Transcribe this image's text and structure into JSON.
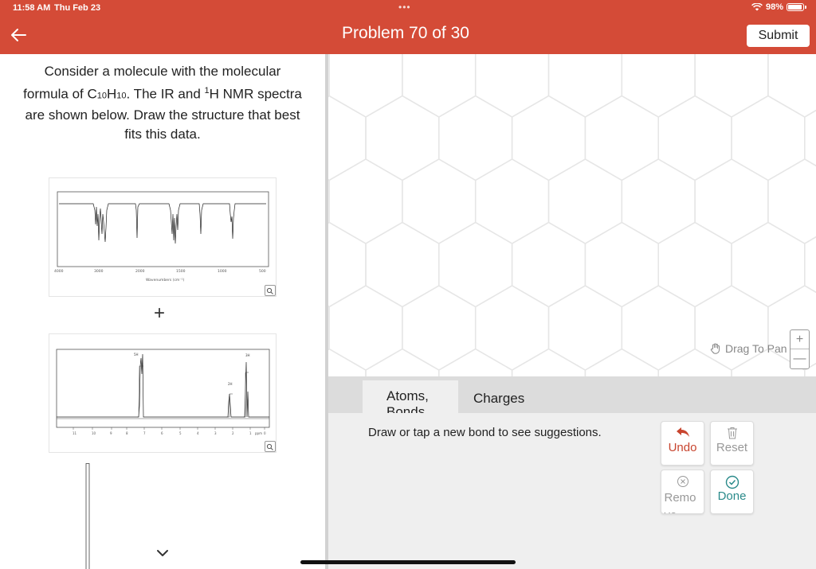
{
  "status_bar": {
    "time": "11:58 AM",
    "date": "Thu Feb 23",
    "battery": "98%"
  },
  "header": {
    "title": "Problem 70 of 30",
    "submit_label": "Submit",
    "color": "#d44b37"
  },
  "question": {
    "line_prefix": "Consider a molecule with the molecular formula of C",
    "c_count": "10",
    "h_label": "H",
    "h_count": "10",
    "mid": ". The IR and ",
    "nmr_sup": "1",
    "rest": "H NMR spectra are shown below. Draw the structure that best fits this data."
  },
  "ir_spectrum": {
    "x_ticks": [
      "4000",
      "3000",
      "2000",
      "1500",
      "1000",
      "500"
    ],
    "x_label": "Wavenumbers (cm⁻¹)"
  },
  "nmr_spectrum": {
    "x_ticks": [
      "11",
      "10",
      "9",
      "8",
      "7",
      "6",
      "5",
      "4",
      "3",
      "2",
      "1",
      "0"
    ],
    "unit": "ppm",
    "integrations": [
      "5H",
      "2H",
      "3H"
    ]
  },
  "plus_symbol": "+",
  "canvas": {
    "drag_to_pan": "Drag To Pan",
    "zoom_in": "+",
    "zoom_out": "—"
  },
  "bottom_panel": {
    "tabs": [
      {
        "label": "Atoms, Bonds"
      },
      {
        "label": "Charges"
      }
    ],
    "hint": "Draw or tap a new bond to see suggestions.",
    "buttons": {
      "undo": "Undo",
      "reset": "Reset",
      "remove": "Remove",
      "done": "Done"
    },
    "colors": {
      "undo": "#c8452f",
      "done": "#2a8a8a",
      "disabled": "#999999"
    }
  }
}
